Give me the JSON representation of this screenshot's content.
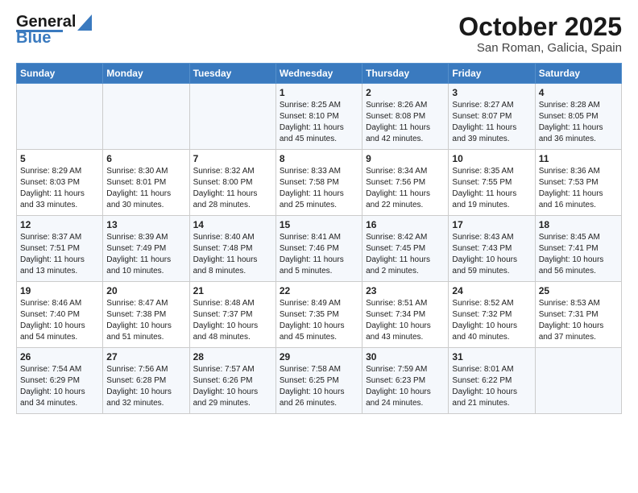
{
  "logo": {
    "line1": "General",
    "line2": "Blue"
  },
  "title": "October 2025",
  "subtitle": "San Roman, Galicia, Spain",
  "days_of_week": [
    "Sunday",
    "Monday",
    "Tuesday",
    "Wednesday",
    "Thursday",
    "Friday",
    "Saturday"
  ],
  "weeks": [
    [
      {
        "day": "",
        "info": ""
      },
      {
        "day": "",
        "info": ""
      },
      {
        "day": "",
        "info": ""
      },
      {
        "day": "1",
        "info": "Sunrise: 8:25 AM\nSunset: 8:10 PM\nDaylight: 11 hours and 45 minutes."
      },
      {
        "day": "2",
        "info": "Sunrise: 8:26 AM\nSunset: 8:08 PM\nDaylight: 11 hours and 42 minutes."
      },
      {
        "day": "3",
        "info": "Sunrise: 8:27 AM\nSunset: 8:07 PM\nDaylight: 11 hours and 39 minutes."
      },
      {
        "day": "4",
        "info": "Sunrise: 8:28 AM\nSunset: 8:05 PM\nDaylight: 11 hours and 36 minutes."
      }
    ],
    [
      {
        "day": "5",
        "info": "Sunrise: 8:29 AM\nSunset: 8:03 PM\nDaylight: 11 hours and 33 minutes."
      },
      {
        "day": "6",
        "info": "Sunrise: 8:30 AM\nSunset: 8:01 PM\nDaylight: 11 hours and 30 minutes."
      },
      {
        "day": "7",
        "info": "Sunrise: 8:32 AM\nSunset: 8:00 PM\nDaylight: 11 hours and 28 minutes."
      },
      {
        "day": "8",
        "info": "Sunrise: 8:33 AM\nSunset: 7:58 PM\nDaylight: 11 hours and 25 minutes."
      },
      {
        "day": "9",
        "info": "Sunrise: 8:34 AM\nSunset: 7:56 PM\nDaylight: 11 hours and 22 minutes."
      },
      {
        "day": "10",
        "info": "Sunrise: 8:35 AM\nSunset: 7:55 PM\nDaylight: 11 hours and 19 minutes."
      },
      {
        "day": "11",
        "info": "Sunrise: 8:36 AM\nSunset: 7:53 PM\nDaylight: 11 hours and 16 minutes."
      }
    ],
    [
      {
        "day": "12",
        "info": "Sunrise: 8:37 AM\nSunset: 7:51 PM\nDaylight: 11 hours and 13 minutes."
      },
      {
        "day": "13",
        "info": "Sunrise: 8:39 AM\nSunset: 7:49 PM\nDaylight: 11 hours and 10 minutes."
      },
      {
        "day": "14",
        "info": "Sunrise: 8:40 AM\nSunset: 7:48 PM\nDaylight: 11 hours and 8 minutes."
      },
      {
        "day": "15",
        "info": "Sunrise: 8:41 AM\nSunset: 7:46 PM\nDaylight: 11 hours and 5 minutes."
      },
      {
        "day": "16",
        "info": "Sunrise: 8:42 AM\nSunset: 7:45 PM\nDaylight: 11 hours and 2 minutes."
      },
      {
        "day": "17",
        "info": "Sunrise: 8:43 AM\nSunset: 7:43 PM\nDaylight: 10 hours and 59 minutes."
      },
      {
        "day": "18",
        "info": "Sunrise: 8:45 AM\nSunset: 7:41 PM\nDaylight: 10 hours and 56 minutes."
      }
    ],
    [
      {
        "day": "19",
        "info": "Sunrise: 8:46 AM\nSunset: 7:40 PM\nDaylight: 10 hours and 54 minutes."
      },
      {
        "day": "20",
        "info": "Sunrise: 8:47 AM\nSunset: 7:38 PM\nDaylight: 10 hours and 51 minutes."
      },
      {
        "day": "21",
        "info": "Sunrise: 8:48 AM\nSunset: 7:37 PM\nDaylight: 10 hours and 48 minutes."
      },
      {
        "day": "22",
        "info": "Sunrise: 8:49 AM\nSunset: 7:35 PM\nDaylight: 10 hours and 45 minutes."
      },
      {
        "day": "23",
        "info": "Sunrise: 8:51 AM\nSunset: 7:34 PM\nDaylight: 10 hours and 43 minutes."
      },
      {
        "day": "24",
        "info": "Sunrise: 8:52 AM\nSunset: 7:32 PM\nDaylight: 10 hours and 40 minutes."
      },
      {
        "day": "25",
        "info": "Sunrise: 8:53 AM\nSunset: 7:31 PM\nDaylight: 10 hours and 37 minutes."
      }
    ],
    [
      {
        "day": "26",
        "info": "Sunrise: 7:54 AM\nSunset: 6:29 PM\nDaylight: 10 hours and 34 minutes."
      },
      {
        "day": "27",
        "info": "Sunrise: 7:56 AM\nSunset: 6:28 PM\nDaylight: 10 hours and 32 minutes."
      },
      {
        "day": "28",
        "info": "Sunrise: 7:57 AM\nSunset: 6:26 PM\nDaylight: 10 hours and 29 minutes."
      },
      {
        "day": "29",
        "info": "Sunrise: 7:58 AM\nSunset: 6:25 PM\nDaylight: 10 hours and 26 minutes."
      },
      {
        "day": "30",
        "info": "Sunrise: 7:59 AM\nSunset: 6:23 PM\nDaylight: 10 hours and 24 minutes."
      },
      {
        "day": "31",
        "info": "Sunrise: 8:01 AM\nSunset: 6:22 PM\nDaylight: 10 hours and 21 minutes."
      },
      {
        "day": "",
        "info": ""
      }
    ]
  ]
}
